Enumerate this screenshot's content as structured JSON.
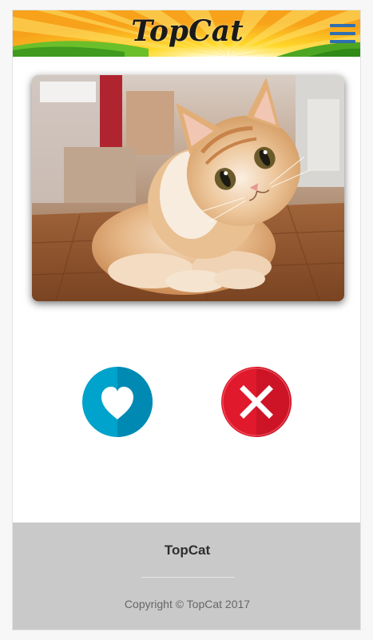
{
  "header": {
    "logo_text": "TopCat",
    "menu_icon": "hamburger-menu-icon"
  },
  "photo": {
    "subject": "cat-photo",
    "alt": "TopCat"
  },
  "actions": {
    "like_icon": "heart-icon",
    "dislike_icon": "close-icon"
  },
  "footer": {
    "title": "TopCat",
    "copyright": "Copyright © TopCat 2017"
  },
  "colors": {
    "menu_blue": "#2f6fb0",
    "like_blue": "#00a3cc",
    "dislike_red": "#e0192c",
    "footer_gray": "#c9c9c9"
  }
}
